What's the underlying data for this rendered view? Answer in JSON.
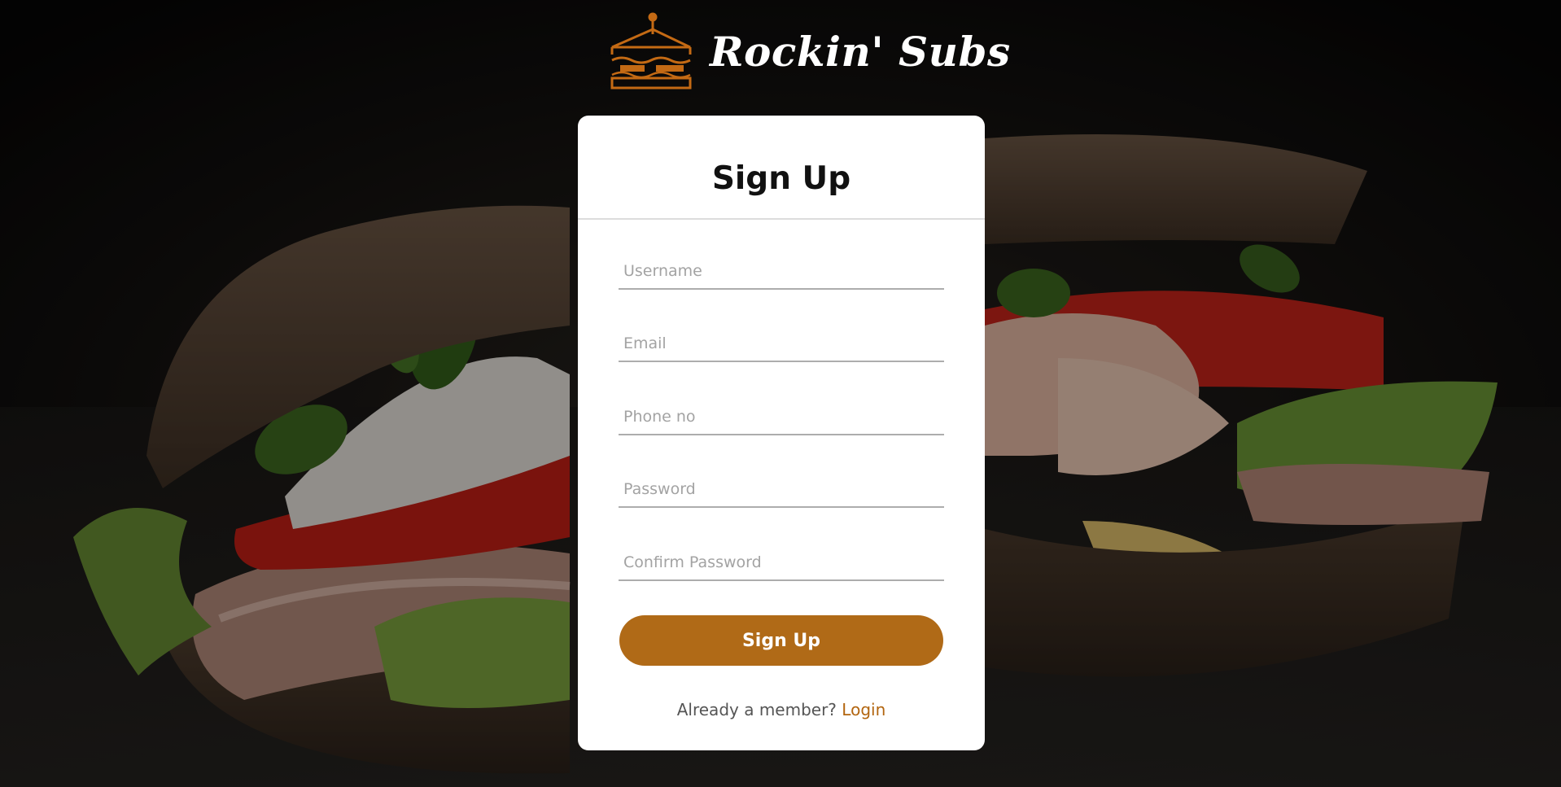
{
  "brand": {
    "name": "Rockin' Subs",
    "accent": "#b06a17",
    "logo_icon": "sandwich-icon"
  },
  "form": {
    "title": "Sign Up",
    "fields": [
      {
        "id": "username",
        "placeholder": "Username",
        "value": ""
      },
      {
        "id": "email",
        "placeholder": "Email",
        "value": ""
      },
      {
        "id": "phone",
        "placeholder": "Phone no",
        "value": ""
      },
      {
        "id": "password",
        "placeholder": "Password",
        "value": ""
      },
      {
        "id": "confirm",
        "placeholder": "Confirm Password",
        "value": ""
      }
    ],
    "submit_label": "Sign Up",
    "member_prompt": "Already a member?",
    "login_label": "Login"
  }
}
